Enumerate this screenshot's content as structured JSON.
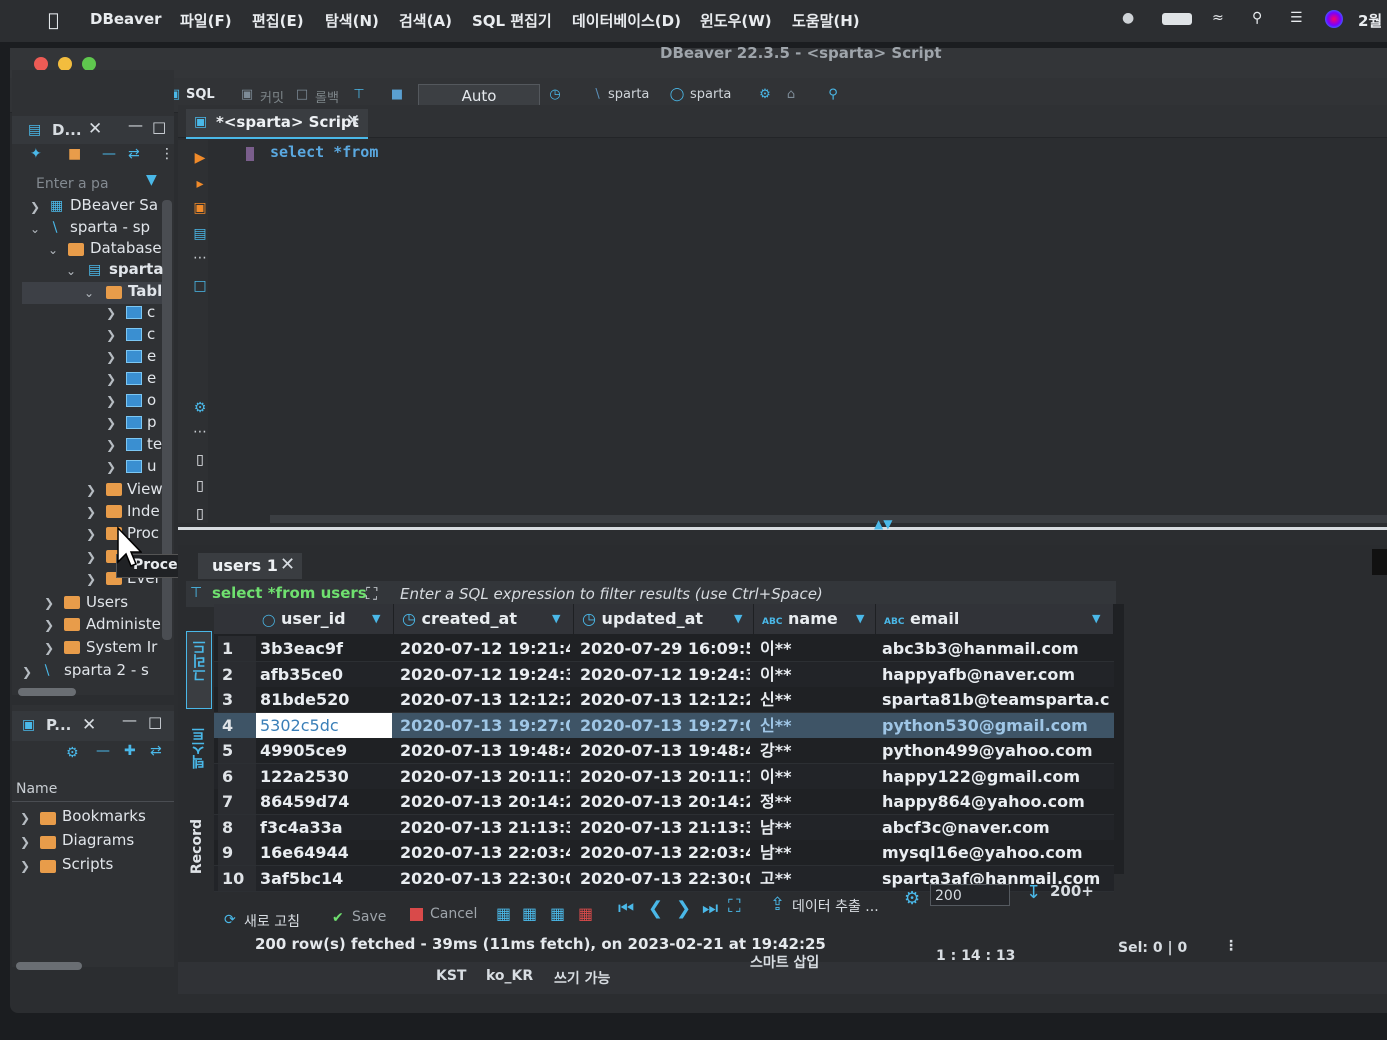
{
  "menubar": {
    "app": "DBeaver",
    "items": [
      "파일(F)",
      "편집(E)",
      "탐색(N)",
      "검색(A)",
      "SQL 편집기",
      "데이터베이스(D)",
      "윈도우(W)",
      "도움말(H)"
    ],
    "clock": "2월"
  },
  "window": {
    "title": "DBeaver 22.3.5 - <sparta> Script"
  },
  "toolbar": {
    "sql_label": "SQL",
    "commit_label": "커밋",
    "rollback_label": "롤백",
    "mode": "Auto",
    "datasource": "sparta",
    "schema": "sparta"
  },
  "navigator": {
    "tab_label": "D...",
    "filter_placeholder": "Enter a pa",
    "items": [
      {
        "label": "DBeaver Sa"
      },
      {
        "label": "sparta  - sp"
      },
      {
        "label": "Database"
      },
      {
        "label": "sparta"
      },
      {
        "label": "Tabl"
      },
      {
        "label": "c"
      },
      {
        "label": "c"
      },
      {
        "label": "e"
      },
      {
        "label": "e"
      },
      {
        "label": "o"
      },
      {
        "label": "p"
      },
      {
        "label": "te"
      },
      {
        "label": "u"
      },
      {
        "label": "View"
      },
      {
        "label": "Inde"
      },
      {
        "label": "Proc"
      },
      {
        "label": "Trig"
      },
      {
        "label": "Ever"
      },
      {
        "label": "Users"
      },
      {
        "label": "Administe"
      },
      {
        "label": "System Ir"
      },
      {
        "label": "sparta 2  - s"
      }
    ],
    "tooltip": "Procedures"
  },
  "projects": {
    "tab_label": "P...",
    "column_name": "Name",
    "items": [
      "Bookmarks",
      "Diagrams",
      "Scripts"
    ]
  },
  "editor": {
    "tab_label": "*<sparta> Script",
    "sql_keyword": "select",
    "sql_rest": "*from"
  },
  "results": {
    "tab_label": "users 1",
    "query_label": "select *from users",
    "filter_placeholder": "Enter a SQL expression to filter results (use Ctrl+Space)",
    "side_tabs": [
      "그리드",
      "텍스트",
      "Record"
    ],
    "columns": [
      {
        "name": "user_id",
        "type": "key"
      },
      {
        "name": "created_at",
        "type": "time"
      },
      {
        "name": "updated_at",
        "type": "time"
      },
      {
        "name": "name",
        "type": "ABC"
      },
      {
        "name": "email",
        "type": "ABC"
      }
    ],
    "rows": [
      {
        "n": "1",
        "user_id": "3b3eac9f",
        "created_at": "2020-07-12 19:21:46",
        "updated_at": "2020-07-29 16:09:55",
        "name": "이**",
        "email": "abc3b3@hanmail.com"
      },
      {
        "n": "2",
        "user_id": "afb35ce0",
        "created_at": "2020-07-12 19:24:32",
        "updated_at": "2020-07-12 19:24:32",
        "name": "이**",
        "email": "happyafb@naver.com"
      },
      {
        "n": "3",
        "user_id": "81bde520",
        "created_at": "2020-07-13 12:12:26",
        "updated_at": "2020-07-13 12:12:26",
        "name": "신**",
        "email": "sparta81b@teamsparta.co"
      },
      {
        "n": "4",
        "user_id": "5302c5dc",
        "created_at": "2020-07-13 19:27:09",
        "updated_at": "2020-07-13 19:27:09",
        "name": "신**",
        "email": "python530@gmail.com"
      },
      {
        "n": "5",
        "user_id": "49905ce9",
        "created_at": "2020-07-13 19:48:46",
        "updated_at": "2020-07-13 19:48:46",
        "name": "강**",
        "email": "python499@yahoo.com"
      },
      {
        "n": "6",
        "user_id": "122a2530",
        "created_at": "2020-07-13 20:11:13",
        "updated_at": "2020-07-13 20:11:13",
        "name": "이**",
        "email": "happy122@gmail.com"
      },
      {
        "n": "7",
        "user_id": "86459d74",
        "created_at": "2020-07-13 20:14:23",
        "updated_at": "2020-07-13 20:14:23",
        "name": "정**",
        "email": "happy864@yahoo.com"
      },
      {
        "n": "8",
        "user_id": "f3c4a33a",
        "created_at": "2020-07-13 21:13:33",
        "updated_at": "2020-07-13 21:13:33",
        "name": "남**",
        "email": "abcf3c@naver.com"
      },
      {
        "n": "9",
        "user_id": "16e64944",
        "created_at": "2020-07-13 22:03:42",
        "updated_at": "2020-07-13 22:03:42",
        "name": "남**",
        "email": "mysql16e@yahoo.com"
      },
      {
        "n": "10",
        "user_id": "3af5bc14",
        "created_at": "2020-07-13 22:30:00",
        "updated_at": "2020-07-13 22:30:00",
        "name": "고**",
        "email": "sparta3af@hanmail.com"
      }
    ],
    "selected_row": "4",
    "bottom": {
      "refresh": "새로 고침",
      "save": "Save",
      "cancel": "Cancel",
      "export": "데이터 추출 ...",
      "fetch_size": "200",
      "fetch_more": "200+"
    },
    "status_text": "200 row(s) fetched - 39ms (11ms fetch), on 2023-02-21 at 19:42:25"
  },
  "statusbar": {
    "timezone": "KST",
    "locale": "ko_KR",
    "mode": "쓰기 가능",
    "insert": "스마트 삽입",
    "position": "1 : 14 : 13",
    "selection": "Sel: 0 | 0"
  },
  "colors": {
    "accent": "#4ab8e8",
    "selected_row": "#3e5466",
    "query_green": "#6fe06f"
  }
}
